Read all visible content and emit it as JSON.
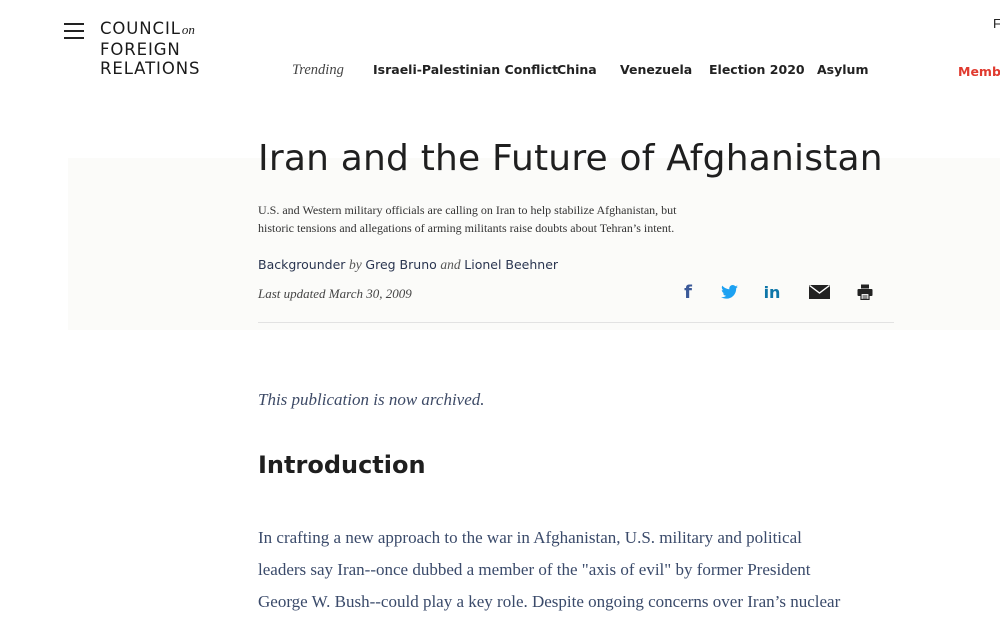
{
  "header": {
    "logo": {
      "line1": "COUNCIL",
      "on": "on",
      "line2": "FOREIGN",
      "line3": "RELATIONS"
    },
    "top_right_letter": "F",
    "membership": "Membe"
  },
  "nav": {
    "trending_label": "Trending",
    "links": [
      "Israeli-Palestinian Conflict",
      "China",
      "Venezuela",
      "Election 2020",
      "Asylum"
    ]
  },
  "article": {
    "title": "Iran and the Future of Afghanistan",
    "subtitle_line1": "U.S. and Western military officials are calling on Iran to help stabilize Afghanistan, but",
    "subtitle_line2": "historic tensions and allegations of arming militants raise doubts about Tehran’s intent.",
    "type": "Backgrounder",
    "by": "by",
    "author1": "Greg Bruno",
    "and": "and",
    "author2": "Lionel Beehner",
    "last_updated": "Last updated March 30, 2009",
    "archived_note": "This publication is now archived.",
    "section_heading": "Introduction",
    "para_line1": "In crafting a new approach to the war in Afghanistan, U.S. military and political",
    "para_line2": "leaders say Iran--once dubbed a member of the \"axis of evil\" by former President",
    "para_line3": "George W. Bush--could play a key role. Despite ongoing concerns over Iran’s nuclear"
  },
  "share": {
    "facebook_glyph": "f",
    "linkedin_glyph": "in",
    "colors": {
      "facebook": "#3b5998",
      "twitter": "#1da1f2",
      "linkedin": "#0e76a8",
      "icon_dark": "#222222"
    }
  },
  "colors": {
    "accent_red": "#e03a2f",
    "body_text": "#3a4a6a"
  }
}
